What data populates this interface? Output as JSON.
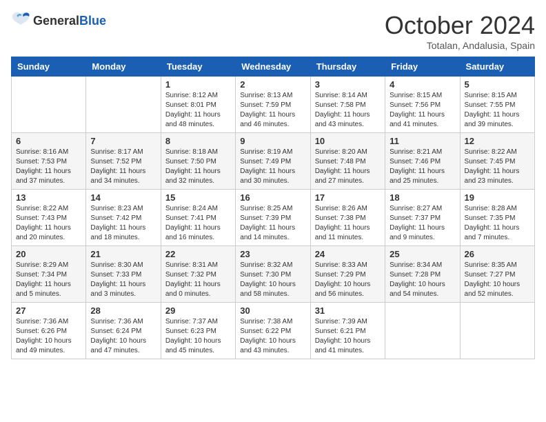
{
  "logo": {
    "general": "General",
    "blue": "Blue"
  },
  "title": "October 2024",
  "subtitle": "Totalan, Andalusia, Spain",
  "days_of_week": [
    "Sunday",
    "Monday",
    "Tuesday",
    "Wednesday",
    "Thursday",
    "Friday",
    "Saturday"
  ],
  "weeks": [
    [
      {
        "day": "",
        "sunrise": "",
        "sunset": "",
        "daylight": ""
      },
      {
        "day": "",
        "sunrise": "",
        "sunset": "",
        "daylight": ""
      },
      {
        "day": "1",
        "sunrise": "Sunrise: 8:12 AM",
        "sunset": "Sunset: 8:01 PM",
        "daylight": "Daylight: 11 hours and 48 minutes."
      },
      {
        "day": "2",
        "sunrise": "Sunrise: 8:13 AM",
        "sunset": "Sunset: 7:59 PM",
        "daylight": "Daylight: 11 hours and 46 minutes."
      },
      {
        "day": "3",
        "sunrise": "Sunrise: 8:14 AM",
        "sunset": "Sunset: 7:58 PM",
        "daylight": "Daylight: 11 hours and 43 minutes."
      },
      {
        "day": "4",
        "sunrise": "Sunrise: 8:15 AM",
        "sunset": "Sunset: 7:56 PM",
        "daylight": "Daylight: 11 hours and 41 minutes."
      },
      {
        "day": "5",
        "sunrise": "Sunrise: 8:15 AM",
        "sunset": "Sunset: 7:55 PM",
        "daylight": "Daylight: 11 hours and 39 minutes."
      }
    ],
    [
      {
        "day": "6",
        "sunrise": "Sunrise: 8:16 AM",
        "sunset": "Sunset: 7:53 PM",
        "daylight": "Daylight: 11 hours and 37 minutes."
      },
      {
        "day": "7",
        "sunrise": "Sunrise: 8:17 AM",
        "sunset": "Sunset: 7:52 PM",
        "daylight": "Daylight: 11 hours and 34 minutes."
      },
      {
        "day": "8",
        "sunrise": "Sunrise: 8:18 AM",
        "sunset": "Sunset: 7:50 PM",
        "daylight": "Daylight: 11 hours and 32 minutes."
      },
      {
        "day": "9",
        "sunrise": "Sunrise: 8:19 AM",
        "sunset": "Sunset: 7:49 PM",
        "daylight": "Daylight: 11 hours and 30 minutes."
      },
      {
        "day": "10",
        "sunrise": "Sunrise: 8:20 AM",
        "sunset": "Sunset: 7:48 PM",
        "daylight": "Daylight: 11 hours and 27 minutes."
      },
      {
        "day": "11",
        "sunrise": "Sunrise: 8:21 AM",
        "sunset": "Sunset: 7:46 PM",
        "daylight": "Daylight: 11 hours and 25 minutes."
      },
      {
        "day": "12",
        "sunrise": "Sunrise: 8:22 AM",
        "sunset": "Sunset: 7:45 PM",
        "daylight": "Daylight: 11 hours and 23 minutes."
      }
    ],
    [
      {
        "day": "13",
        "sunrise": "Sunrise: 8:22 AM",
        "sunset": "Sunset: 7:43 PM",
        "daylight": "Daylight: 11 hours and 20 minutes."
      },
      {
        "day": "14",
        "sunrise": "Sunrise: 8:23 AM",
        "sunset": "Sunset: 7:42 PM",
        "daylight": "Daylight: 11 hours and 18 minutes."
      },
      {
        "day": "15",
        "sunrise": "Sunrise: 8:24 AM",
        "sunset": "Sunset: 7:41 PM",
        "daylight": "Daylight: 11 hours and 16 minutes."
      },
      {
        "day": "16",
        "sunrise": "Sunrise: 8:25 AM",
        "sunset": "Sunset: 7:39 PM",
        "daylight": "Daylight: 11 hours and 14 minutes."
      },
      {
        "day": "17",
        "sunrise": "Sunrise: 8:26 AM",
        "sunset": "Sunset: 7:38 PM",
        "daylight": "Daylight: 11 hours and 11 minutes."
      },
      {
        "day": "18",
        "sunrise": "Sunrise: 8:27 AM",
        "sunset": "Sunset: 7:37 PM",
        "daylight": "Daylight: 11 hours and 9 minutes."
      },
      {
        "day": "19",
        "sunrise": "Sunrise: 8:28 AM",
        "sunset": "Sunset: 7:35 PM",
        "daylight": "Daylight: 11 hours and 7 minutes."
      }
    ],
    [
      {
        "day": "20",
        "sunrise": "Sunrise: 8:29 AM",
        "sunset": "Sunset: 7:34 PM",
        "daylight": "Daylight: 11 hours and 5 minutes."
      },
      {
        "day": "21",
        "sunrise": "Sunrise: 8:30 AM",
        "sunset": "Sunset: 7:33 PM",
        "daylight": "Daylight: 11 hours and 3 minutes."
      },
      {
        "day": "22",
        "sunrise": "Sunrise: 8:31 AM",
        "sunset": "Sunset: 7:32 PM",
        "daylight": "Daylight: 11 hours and 0 minutes."
      },
      {
        "day": "23",
        "sunrise": "Sunrise: 8:32 AM",
        "sunset": "Sunset: 7:30 PM",
        "daylight": "Daylight: 10 hours and 58 minutes."
      },
      {
        "day": "24",
        "sunrise": "Sunrise: 8:33 AM",
        "sunset": "Sunset: 7:29 PM",
        "daylight": "Daylight: 10 hours and 56 minutes."
      },
      {
        "day": "25",
        "sunrise": "Sunrise: 8:34 AM",
        "sunset": "Sunset: 7:28 PM",
        "daylight": "Daylight: 10 hours and 54 minutes."
      },
      {
        "day": "26",
        "sunrise": "Sunrise: 8:35 AM",
        "sunset": "Sunset: 7:27 PM",
        "daylight": "Daylight: 10 hours and 52 minutes."
      }
    ],
    [
      {
        "day": "27",
        "sunrise": "Sunrise: 7:36 AM",
        "sunset": "Sunset: 6:26 PM",
        "daylight": "Daylight: 10 hours and 49 minutes."
      },
      {
        "day": "28",
        "sunrise": "Sunrise: 7:36 AM",
        "sunset": "Sunset: 6:24 PM",
        "daylight": "Daylight: 10 hours and 47 minutes."
      },
      {
        "day": "29",
        "sunrise": "Sunrise: 7:37 AM",
        "sunset": "Sunset: 6:23 PM",
        "daylight": "Daylight: 10 hours and 45 minutes."
      },
      {
        "day": "30",
        "sunrise": "Sunrise: 7:38 AM",
        "sunset": "Sunset: 6:22 PM",
        "daylight": "Daylight: 10 hours and 43 minutes."
      },
      {
        "day": "31",
        "sunrise": "Sunrise: 7:39 AM",
        "sunset": "Sunset: 6:21 PM",
        "daylight": "Daylight: 10 hours and 41 minutes."
      },
      {
        "day": "",
        "sunrise": "",
        "sunset": "",
        "daylight": ""
      },
      {
        "day": "",
        "sunrise": "",
        "sunset": "",
        "daylight": ""
      }
    ]
  ]
}
